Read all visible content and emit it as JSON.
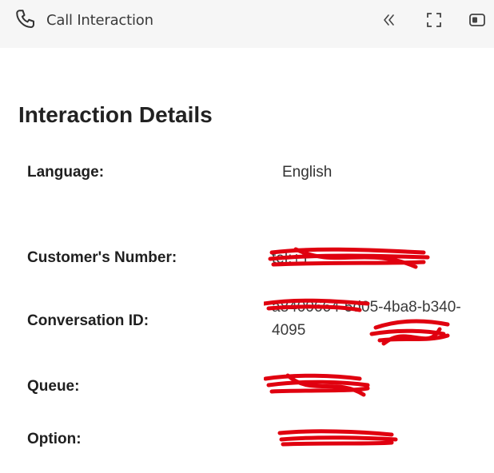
{
  "header": {
    "title": "Call Interaction",
    "icons": [
      "phone-icon",
      "double-chevron-left-icon",
      "fullscreen-icon",
      "panel-toggle-icon"
    ]
  },
  "details": {
    "heading": "Interaction Details",
    "rows": [
      {
        "label": "Language:",
        "value": "English"
      },
      {
        "label": "Customer's Number:",
        "value": "tel:+1"
      },
      {
        "label": "Conversation ID:",
        "value": "a8400664-5d05-4ba8-b340-4095"
      },
      {
        "label": "Queue:",
        "value": ""
      },
      {
        "label": "Option:",
        "value": ""
      }
    ]
  },
  "colors": {
    "topbar_bg": "#f6f6f6",
    "redaction": "#e0000f"
  }
}
